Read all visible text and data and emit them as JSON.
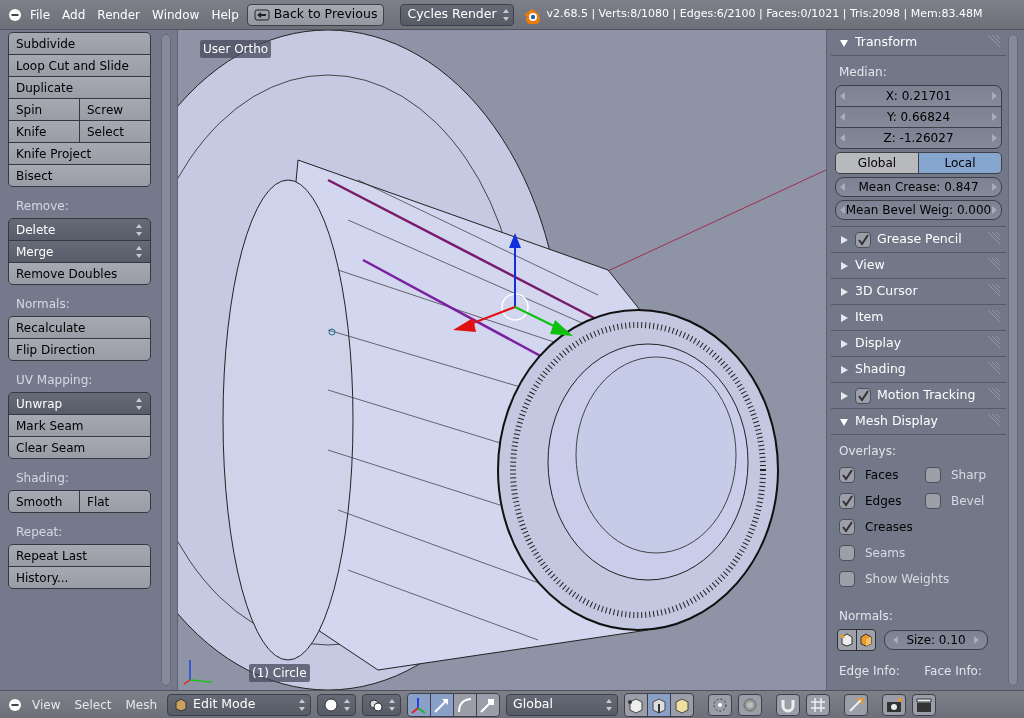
{
  "top_bar": {
    "menus": [
      "File",
      "Add",
      "Render",
      "Window",
      "Help"
    ],
    "back_button": "Back to Previous",
    "render_engine": "Cycles Render",
    "stats": "v2.68.5 | Verts:8/1080 | Edges:6/2100 | Faces:0/1021 | Tris:2098 | Mem:83.48M"
  },
  "tool_shelf": {
    "sections": [
      {
        "rows": [
          [
            {
              "label": "Subdivide",
              "kind": "button"
            }
          ],
          [
            {
              "label": "Loop Cut and Slide",
              "kind": "button"
            }
          ],
          [
            {
              "label": "Duplicate",
              "kind": "button"
            }
          ],
          [
            {
              "label": "Spin",
              "kind": "button"
            },
            {
              "label": "Screw",
              "kind": "button"
            }
          ],
          [
            {
              "label": "Knife",
              "kind": "button"
            },
            {
              "label": "Select",
              "kind": "button"
            }
          ],
          [
            {
              "label": "Knife Project",
              "kind": "button"
            }
          ],
          [
            {
              "label": "Bisect",
              "kind": "button"
            }
          ]
        ]
      },
      {
        "heading": "Remove:",
        "rows": [
          [
            {
              "label": "Delete",
              "kind": "dropdown"
            }
          ],
          [
            {
              "label": "Merge",
              "kind": "dropdown"
            }
          ],
          [
            {
              "label": "Remove Doubles",
              "kind": "button"
            }
          ]
        ]
      },
      {
        "heading": "Normals:",
        "rows": [
          [
            {
              "label": "Recalculate",
              "kind": "button"
            }
          ],
          [
            {
              "label": "Flip Direction",
              "kind": "button"
            }
          ]
        ]
      },
      {
        "heading": "UV Mapping:",
        "rows": [
          [
            {
              "label": "Unwrap",
              "kind": "dropdown"
            }
          ],
          [
            {
              "label": "Mark Seam",
              "kind": "button"
            }
          ],
          [
            {
              "label": "Clear Seam",
              "kind": "button"
            }
          ]
        ]
      },
      {
        "heading": "Shading:",
        "rows": [
          [
            {
              "label": "Smooth",
              "kind": "button"
            },
            {
              "label": "Flat",
              "kind": "button"
            }
          ]
        ]
      },
      {
        "heading": "Repeat:",
        "rows": [
          [
            {
              "label": "Repeat Last",
              "kind": "button"
            }
          ],
          [
            {
              "label": "History...",
              "kind": "button"
            }
          ]
        ]
      }
    ]
  },
  "viewport": {
    "view_label": "User Ortho",
    "object_label": "(1) Circle"
  },
  "properties": {
    "transform": {
      "title": "Transform",
      "expanded": true,
      "median_label": "Median:",
      "fields": [
        "X: 0.21701",
        "Y: 0.66824",
        "Z: -1.26027"
      ],
      "space": [
        {
          "label": "Global",
          "selected": false
        },
        {
          "label": "Local",
          "selected": true
        }
      ],
      "mean_fields": [
        "Mean Crease: 0.847",
        "Mean Bevel Weig: 0.000"
      ]
    },
    "panels": [
      {
        "title": "Grease Pencil",
        "kind": "checkbox",
        "checked": true
      },
      {
        "title": "View",
        "kind": "plain"
      },
      {
        "title": "3D Cursor",
        "kind": "plain"
      },
      {
        "title": "Item",
        "kind": "plain"
      },
      {
        "title": "Display",
        "kind": "plain"
      },
      {
        "title": "Shading",
        "kind": "plain"
      },
      {
        "title": "Motion Tracking",
        "kind": "checkbox",
        "checked": true
      }
    ],
    "mesh_display": {
      "title": "Mesh Display",
      "expanded": true,
      "overlays_label": "Overlays:",
      "overlays": [
        {
          "label": "Faces",
          "checked": true
        },
        {
          "label": "Sharp",
          "checked": false
        },
        {
          "label": "Edges",
          "checked": true
        },
        {
          "label": "Bevel",
          "checked": false
        },
        {
          "label": "Creases",
          "checked": true
        },
        {
          "label": "Seams",
          "checked": false
        },
        {
          "label": "Show Weights",
          "checked": false
        }
      ],
      "normals_label": "Normals:",
      "normals_size": "Size: 0.10",
      "edge_info_label": "Edge Info:",
      "face_info_label": "Face Info:"
    }
  },
  "bottom_bar": {
    "menus": [
      "View",
      "Select",
      "Mesh"
    ],
    "mode": "Edit Mode",
    "orientation": "Global",
    "manipulators": [
      {
        "selected": true
      },
      {
        "selected": true
      },
      {
        "selected": false
      },
      {
        "selected": false
      }
    ],
    "select_modes": [
      {
        "selected": false
      },
      {
        "selected": true
      },
      {
        "selected": false
      }
    ]
  }
}
